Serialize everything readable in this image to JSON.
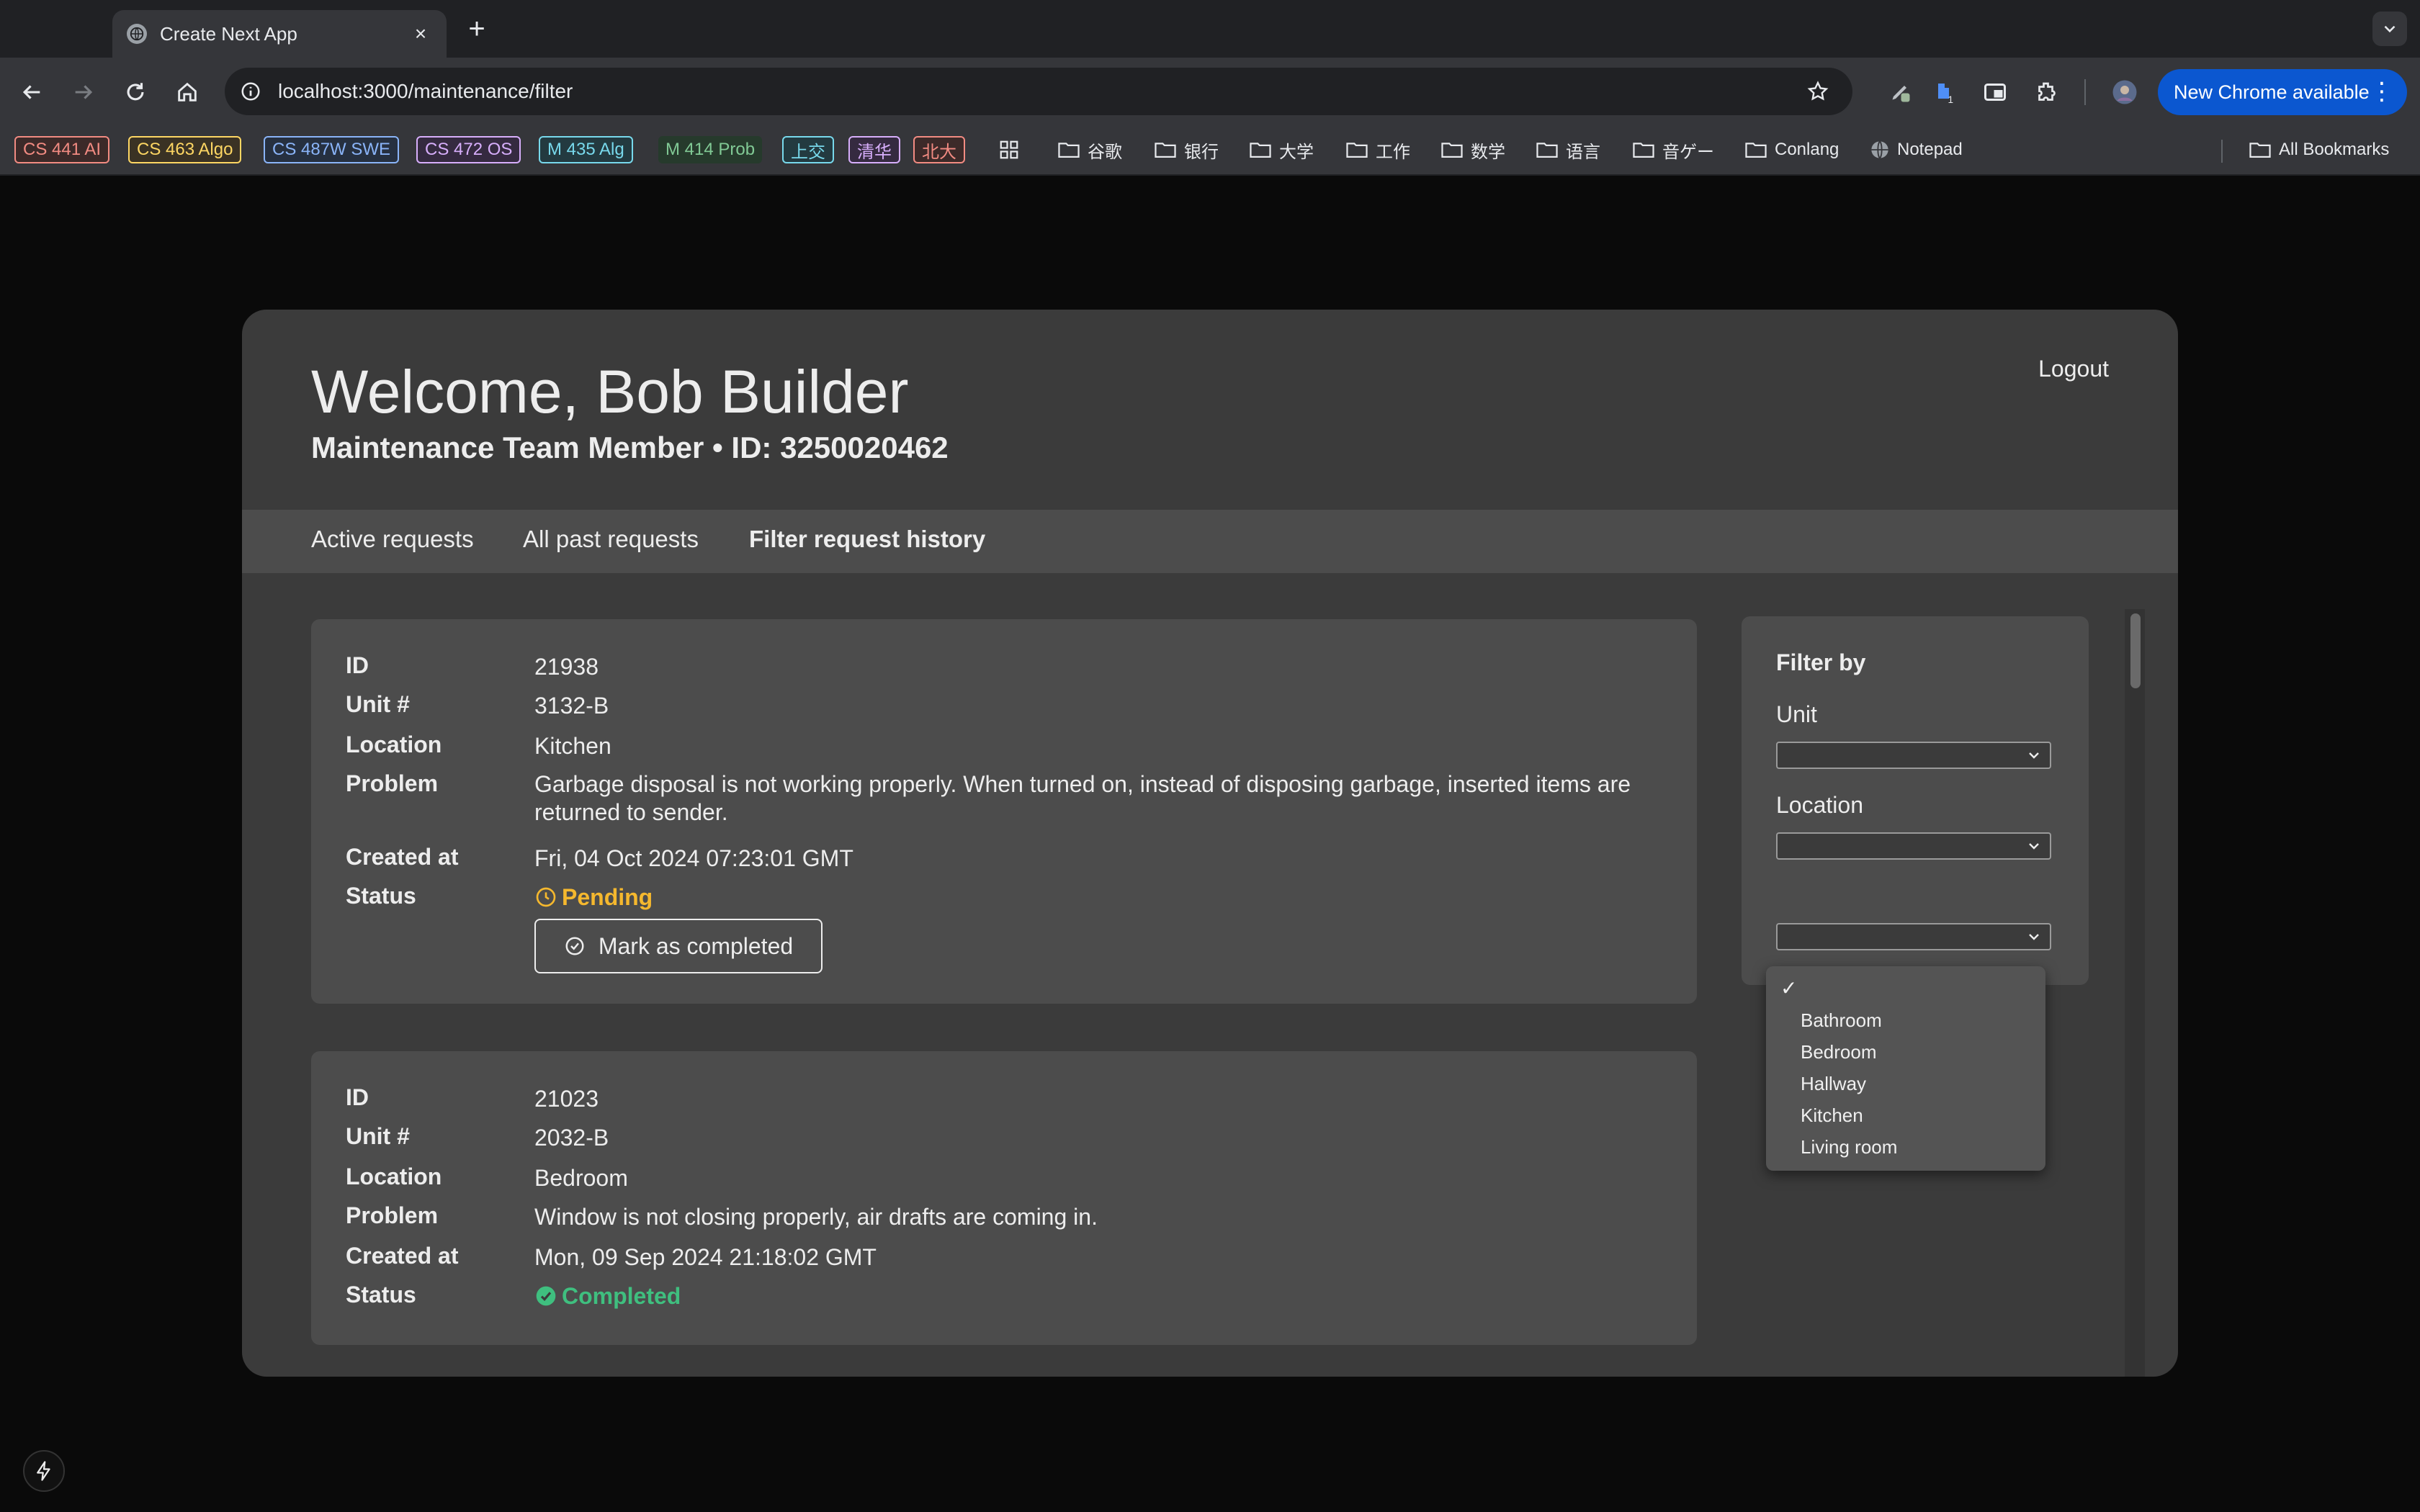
{
  "browser": {
    "tab_title": "Create Next App",
    "tab_close": "×",
    "new_tab": "+",
    "url": "localhost:3000/maintenance/filter",
    "update_label": "New Chrome available",
    "update_menu": "⋮"
  },
  "bookmarks": [
    {
      "label": "CS 441 AI",
      "color": "#f28b82",
      "bg": "#3c2a29",
      "style": "badge"
    },
    {
      "label": "CS 463 Algo",
      "color": "#fdd663",
      "bg": "#3a3224",
      "style": "badge"
    },
    {
      "label": "CS 487W SWE",
      "color": "#8ab4f8",
      "bg": "#263040",
      "style": "badge"
    },
    {
      "label": "CS 472 OS",
      "color": "#d7aefb",
      "bg": "#352a40",
      "style": "badge"
    },
    {
      "label": "M 435 Alg",
      "color": "#78d9ec",
      "bg": "#233a40",
      "style": "badge"
    },
    {
      "label": "M 414 Prob",
      "color": "#81c995",
      "bg": "#263a2c",
      "style": "badge-noborder"
    },
    {
      "label": "上交",
      "color": "#78d9ec",
      "bg": "#233a40",
      "style": "badge"
    },
    {
      "label": "清华",
      "color": "#d7aefb",
      "bg": "#352a40",
      "style": "badge"
    },
    {
      "label": "北大",
      "color": "#f28b82",
      "bg": "#3c2a29",
      "style": "badge"
    },
    {
      "label": "谷歌",
      "style": "folder"
    },
    {
      "label": "银行",
      "style": "folder"
    },
    {
      "label": "大学",
      "style": "folder"
    },
    {
      "label": "工作",
      "style": "folder"
    },
    {
      "label": "数学",
      "style": "folder"
    },
    {
      "label": "语言",
      "style": "folder"
    },
    {
      "label": "音ゲー",
      "style": "folder"
    },
    {
      "label": "Conlang",
      "style": "folder"
    },
    {
      "label": "Notepad",
      "style": "globe"
    },
    {
      "label": "All Bookmarks",
      "style": "folder"
    }
  ],
  "header": {
    "welcome": "Welcome, Bob Builder",
    "subtitle": "Maintenance Team Member • ID: 3250020462",
    "logout": "Logout"
  },
  "nav": {
    "active_requests": "Active requests",
    "past_requests": "All past requests",
    "filter_history": "Filter request history"
  },
  "field_labels": {
    "id": "ID",
    "unit": "Unit #",
    "location": "Location",
    "problem": "Problem",
    "created": "Created at",
    "status": "Status"
  },
  "requests": [
    {
      "id": "21938",
      "unit": "3132-B",
      "location": "Kitchen",
      "problem": "Garbage disposal is not working properly. When turned on, instead of disposing garbage, inserted items are returned to sender.",
      "created": "Fri, 04 Oct 2024 07:23:01 GMT",
      "status": "Pending",
      "action": "Mark as completed"
    },
    {
      "id": "21023",
      "unit": "2032-B",
      "location": "Bedroom",
      "problem": "Window is not closing properly, air drafts are coming in.",
      "created": "Mon, 09 Sep 2024 21:18:02 GMT",
      "status": "Completed"
    }
  ],
  "filter": {
    "heading": "Filter by",
    "unit_label": "Unit",
    "location_label": "Location",
    "unit_value": "",
    "location_value": "",
    "location_options": [
      "Bathroom",
      "Bedroom",
      "Hallway",
      "Kitchen",
      "Living room"
    ],
    "selected_check": "✓"
  },
  "colors": {
    "pending": "#f5b82e",
    "completed": "#3fbf7f",
    "card_bg": "#3b3b3b",
    "request_bg": "#4c4c4c",
    "chrome_accent": "#0b57d0"
  }
}
